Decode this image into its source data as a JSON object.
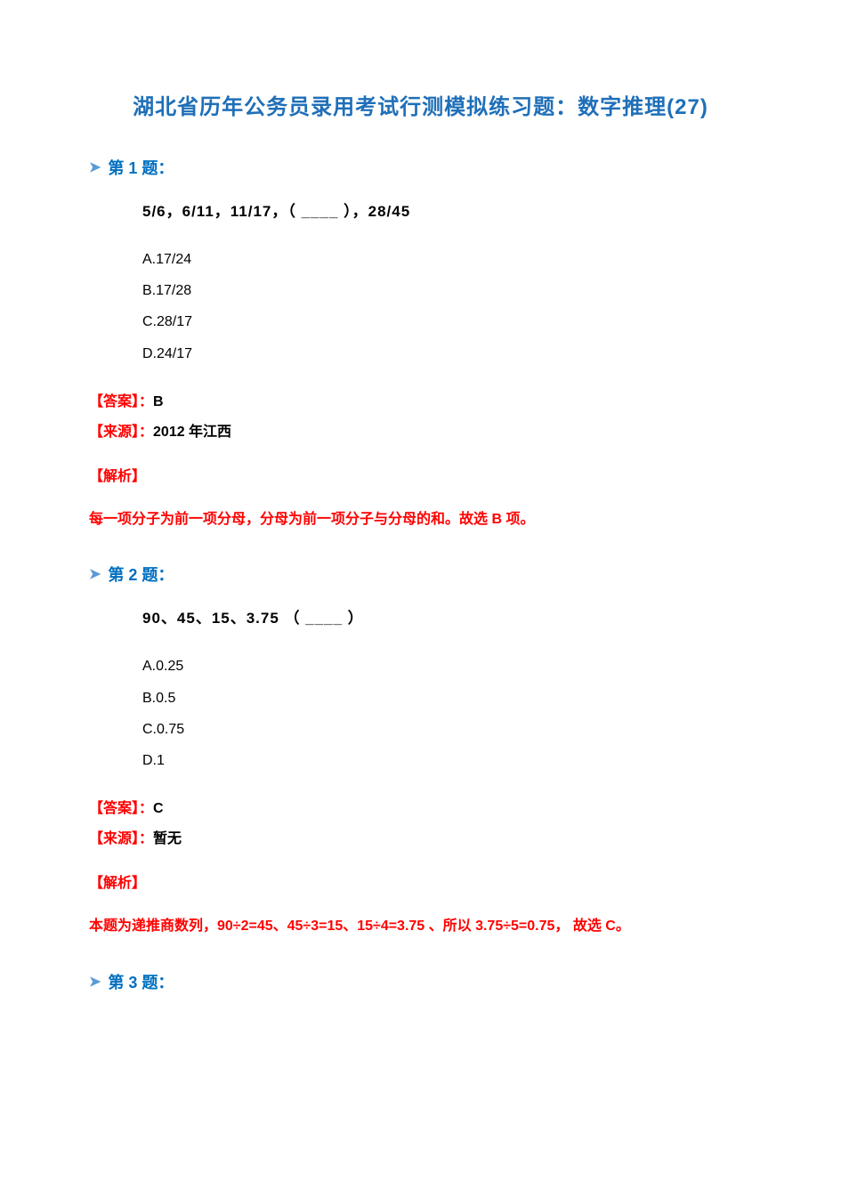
{
  "title": "湖北省历年公务员录用考试行测模拟练习题：数字推理(27)",
  "question1": {
    "header": "第 1 题：",
    "sequence": "5/6，6/11，11/17，（ ____ ），28/45",
    "options": {
      "a": "A.17/24",
      "b": "B.17/28",
      "c": "C.28/17",
      "d": "D.24/17"
    },
    "answer_label": "【答案】：",
    "answer_value": "B",
    "source_label": "【来源】：",
    "source_value": "2012 年江西",
    "analysis_label": "【解析】",
    "analysis_content": "每一项分子为前一项分母，分母为前一项分子与分母的和。故选 B 项。"
  },
  "question2": {
    "header": "第 2 题：",
    "sequence": "90、45、15、3.75 （ ____ ）",
    "options": {
      "a": "A.0.25",
      "b": "B.0.5",
      "c": "C.0.75",
      "d": "D.1"
    },
    "answer_label": "【答案】：",
    "answer_value": "C",
    "source_label": "【来源】：",
    "source_value": "暂无",
    "analysis_label": "【解析】",
    "analysis_content": "本题为递推商数列，90÷2=45、45÷3=15、15÷4=3.75 、所以 3.75÷5=0.75， 故选 C。"
  },
  "question3": {
    "header": "第 3 题："
  },
  "bullet": "➤"
}
